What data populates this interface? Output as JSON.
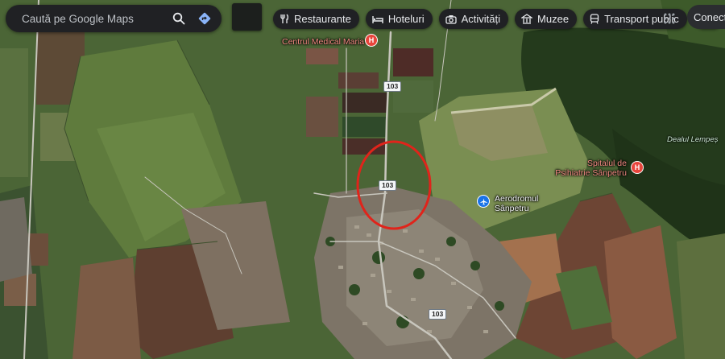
{
  "search": {
    "placeholder": "Caută pe Google Maps"
  },
  "chips": [
    {
      "label": "Restaurante",
      "icon": "fork-knife-icon"
    },
    {
      "label": "Hoteluri",
      "icon": "bed-icon"
    },
    {
      "label": "Activități",
      "icon": "camera-icon"
    },
    {
      "label": "Muzee",
      "icon": "museum-icon"
    },
    {
      "label": "Transport public",
      "icon": "train-icon"
    }
  ],
  "header": {
    "signin_label": "Conectați-vă"
  },
  "map": {
    "road_number": "103",
    "pois": {
      "medical_center": "Centrul Medical Maria",
      "hospital_line1": "Spitalul de",
      "hospital_line2": "Psihiatrie Sânpetru",
      "airfield_line1": "Aerodromul",
      "airfield_line2": "Sânpetru"
    },
    "natural_feature": "Dealul Lempeș",
    "hospital_pin_letter": "H",
    "annotation_color": "#e0241b",
    "accent_color": "#1a73e8",
    "hospital_color": "#e8453c"
  }
}
